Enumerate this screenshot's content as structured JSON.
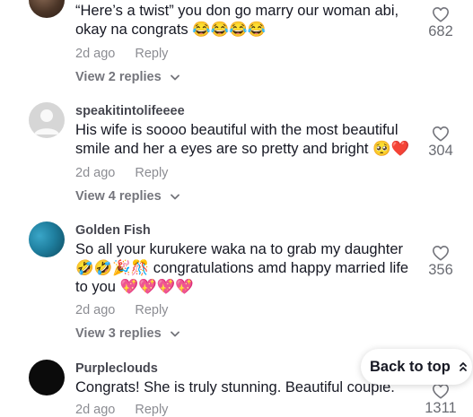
{
  "comments": [
    {
      "username": "",
      "text": "“Here’s a twist” you don go marry our woman abi, okay na congrats 😂😂😂😂",
      "time": "2d ago",
      "reply_label": "Reply",
      "view_replies": "View 2 replies",
      "likes": "682"
    },
    {
      "username": "speakitintolifeeee",
      "text": "His wife is soooo beautiful with the most beautiful smile and her a eyes are so pretty and bright 🥺❤️",
      "time": "2d ago",
      "reply_label": "Reply",
      "view_replies": "View 4 replies",
      "likes": "304"
    },
    {
      "username": "Golden Fish",
      "text": "So all your kurukere waka na to grab my daughter 🤣🤣🎉🎊 congratulations amd happy married life to you 💖💖💖💖",
      "time": "2d ago",
      "reply_label": "Reply",
      "view_replies": "View 3 replies",
      "likes": "356"
    },
    {
      "username": "Purpleclouds",
      "text": "Congrats! She is truly stunning. Beautiful couple.",
      "time": "2d ago",
      "reply_label": "Reply",
      "view_replies": "",
      "likes": "1311"
    }
  ],
  "back_to_top": {
    "label": "Back to top",
    "icon": "double-chevron-up-icon"
  }
}
